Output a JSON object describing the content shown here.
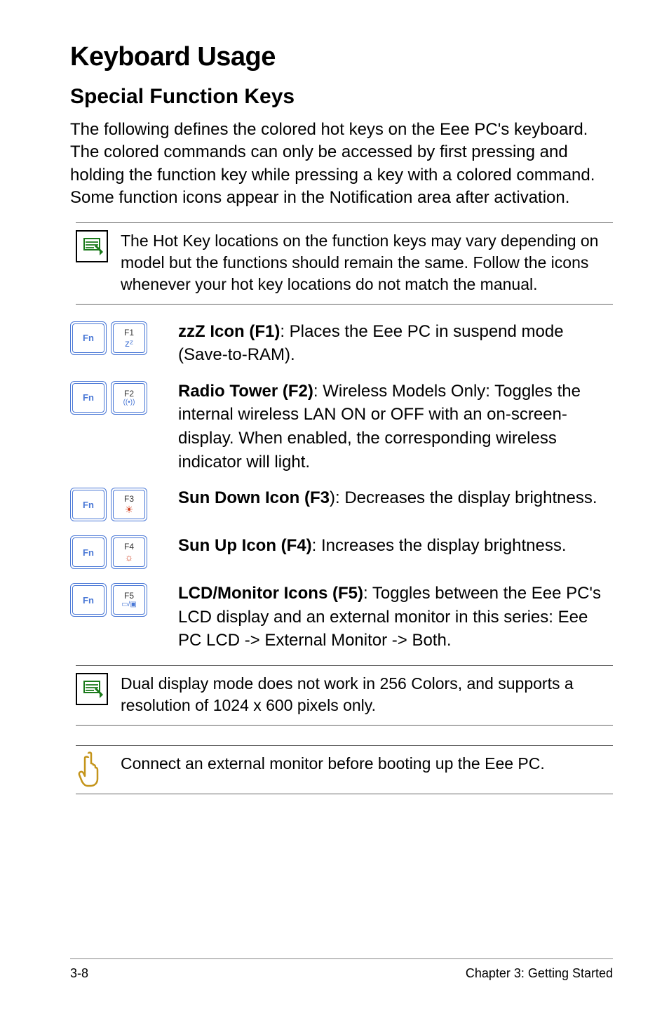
{
  "title": "Keyboard Usage",
  "subtitle": "Special Function Keys",
  "intro": "The following defines the colored hot keys on the Eee PC's keyboard. The colored commands can only be accessed by first pressing and holding the function key while pressing a key with a colored command. Some function icons appear in the Notification area after activation.",
  "note1": "The Hot Key locations on the function keys may vary depending on model but the functions should remain the same. Follow the icons whenever your hot key locations do not match the manual.",
  "keys": {
    "fn": "Fn",
    "f1": {
      "label": "F1",
      "glyph": "zᶻ",
      "lead": "zzZ Icon (F1)",
      "desc": ": Places the Eee PC in suspend mode  (Save-to-RAM)."
    },
    "f2": {
      "label": "F2",
      "glyph": "((•))",
      "lead": "Radio Tower (F2)",
      "desc": ": Wireless Models Only: Toggles the internal wireless LAN ON or OFF with an on-screen-display. When enabled, the corresponding wireless indicator will light."
    },
    "f3": {
      "label": "F3",
      "glyph": "☀",
      "lead": "Sun Down Icon (F3",
      "desc": "): Decreases the display brightness."
    },
    "f4": {
      "label": "F4",
      "glyph": "☼",
      "lead": "Sun Up Icon (F4)",
      "desc": ": Increases the display brightness."
    },
    "f5": {
      "label": "F5",
      "glyph": "▭/▣",
      "lead": "LCD/Monitor Icons (F5)",
      "desc": ": Toggles between the Eee PC's LCD display and an external monitor in this series: Eee PC LCD -> External Monitor -> Both."
    }
  },
  "note2": "Dual display mode does not work in 256 Colors, and supports a resolution of 1024 x 600 pixels only.",
  "note3": "Connect an external monitor before booting up the Eee PC.",
  "footer": {
    "left": "3-8",
    "right": "Chapter 3: Getting Started"
  }
}
